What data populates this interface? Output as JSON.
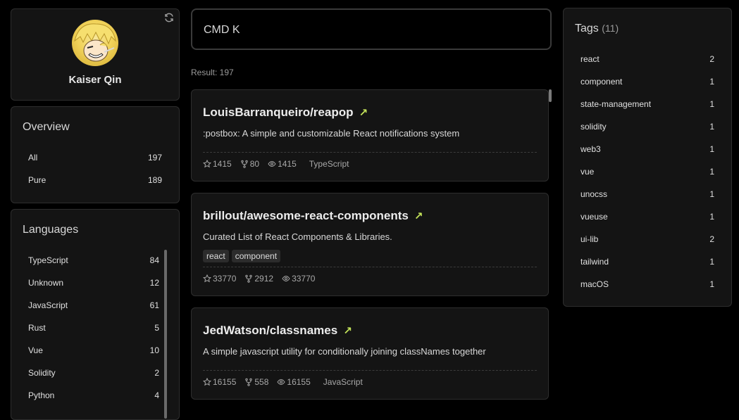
{
  "profile": {
    "name": "Kaiser Qin"
  },
  "overview": {
    "title": "Overview",
    "items": [
      {
        "label": "All",
        "count": "197"
      },
      {
        "label": "Pure",
        "count": "189"
      }
    ]
  },
  "languages": {
    "title": "Languages",
    "items": [
      {
        "label": "TypeScript",
        "count": "84"
      },
      {
        "label": "Unknown",
        "count": "12"
      },
      {
        "label": "JavaScript",
        "count": "61"
      },
      {
        "label": "Rust",
        "count": "5"
      },
      {
        "label": "Vue",
        "count": "10"
      },
      {
        "label": "Solidity",
        "count": "2"
      },
      {
        "label": "Python",
        "count": "4"
      }
    ]
  },
  "search": {
    "placeholder": "CMD K"
  },
  "result": {
    "text": "Result: 197"
  },
  "repos": [
    {
      "name": "LouisBarranqueiro/reapop",
      "description": ":postbox: A simple and customizable React notifications system",
      "tags": [],
      "stars": "1415",
      "forks": "80",
      "watchers": "1415",
      "language": "TypeScript"
    },
    {
      "name": "brillout/awesome-react-components",
      "description": "Curated List of React Components & Libraries.",
      "tags": [
        "react",
        "component"
      ],
      "stars": "33770",
      "forks": "2912",
      "watchers": "33770",
      "language": ""
    },
    {
      "name": "JedWatson/classnames",
      "description": "A simple javascript utility for conditionally joining classNames together",
      "tags": [],
      "stars": "16155",
      "forks": "558",
      "watchers": "16155",
      "language": "JavaScript"
    }
  ],
  "tags": {
    "title": "Tags",
    "count": "(11)",
    "items": [
      {
        "label": "react",
        "count": "2"
      },
      {
        "label": "component",
        "count": "1"
      },
      {
        "label": "state-management",
        "count": "1"
      },
      {
        "label": "solidity",
        "count": "1"
      },
      {
        "label": "web3",
        "count": "1"
      },
      {
        "label": "vue",
        "count": "1"
      },
      {
        "label": "unocss",
        "count": "1"
      },
      {
        "label": "vueuse",
        "count": "1"
      },
      {
        "label": "ui-lib",
        "count": "2"
      },
      {
        "label": "tailwind",
        "count": "1"
      },
      {
        "label": "macOS",
        "count": "1"
      }
    ]
  },
  "colors": {
    "accent": "#c4e45a",
    "background": "#000000",
    "card": "#141414"
  },
  "icons": {
    "refresh": "refresh-icon",
    "star": "star-icon",
    "fork": "fork-icon",
    "eye": "eye-icon",
    "external": "external-link-arrow-icon"
  }
}
